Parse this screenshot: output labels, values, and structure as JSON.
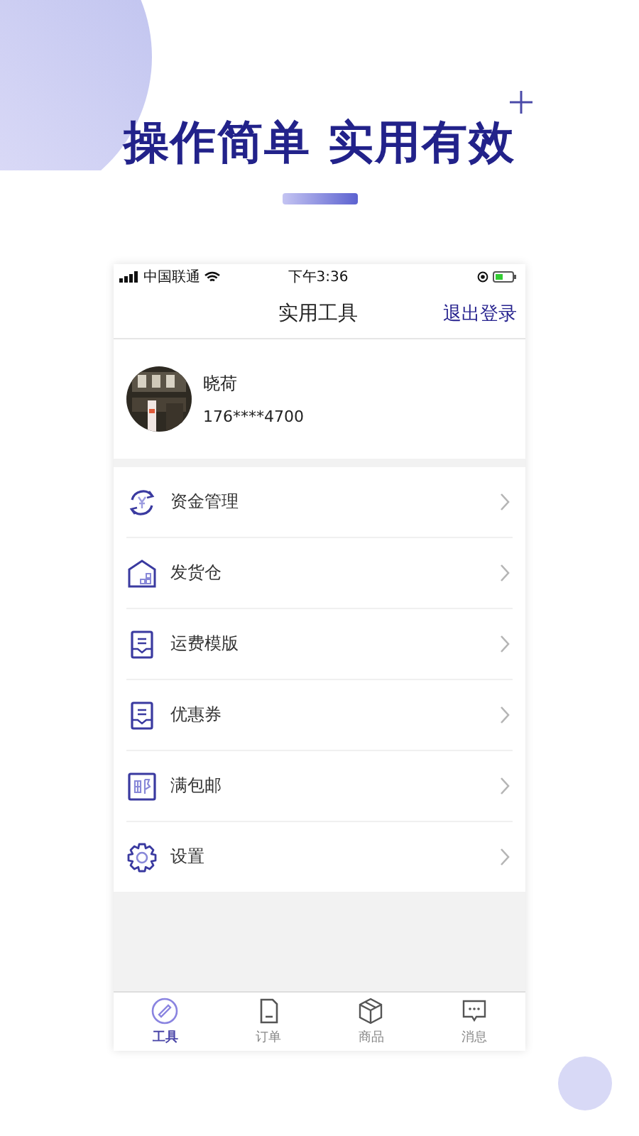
{
  "headline": "操作简单 实用有效",
  "status_bar": {
    "carrier": "中国联通",
    "time": "下午3:36"
  },
  "nav": {
    "title": "实用工具",
    "action": "退出登录"
  },
  "profile": {
    "name": "晓荷",
    "phone": "176****4700"
  },
  "menu": [
    {
      "kind": "money",
      "label": "资金管理"
    },
    {
      "kind": "warehouse",
      "label": "发货仓"
    },
    {
      "kind": "template",
      "label": "运费模版"
    },
    {
      "kind": "template",
      "label": "优惠券"
    },
    {
      "kind": "post",
      "label": "满包邮"
    },
    {
      "kind": "settings",
      "label": "设置"
    }
  ],
  "tabs": [
    {
      "kind": "tools",
      "label": "工具",
      "selected": true
    },
    {
      "kind": "orders",
      "label": "订单",
      "selected": false
    },
    {
      "kind": "goods",
      "label": "商品",
      "selected": false
    },
    {
      "kind": "messages",
      "label": "消息",
      "selected": false
    }
  ]
}
